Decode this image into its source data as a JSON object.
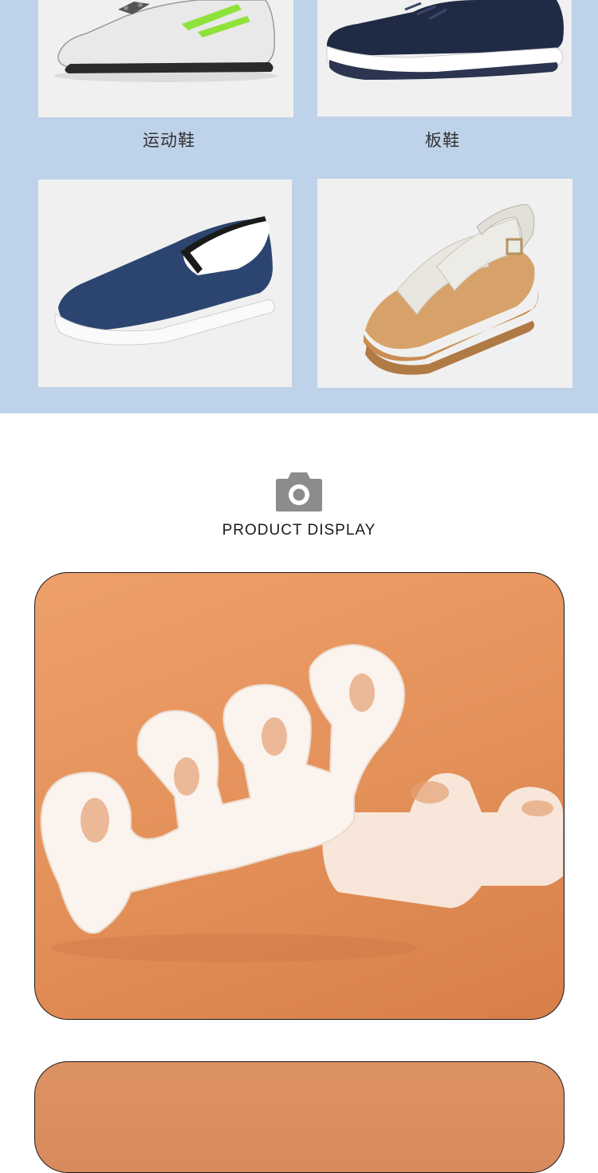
{
  "categories": [
    {
      "label": "运动鞋",
      "image": "sneaker"
    },
    {
      "label": "板鞋",
      "image": "knit-sneaker"
    },
    {
      "label": "",
      "image": "canvas-slip-on"
    },
    {
      "label": "",
      "image": "sandal"
    }
  ],
  "section": {
    "title": "PRODUCT DISPLAY",
    "icon": "camera-icon"
  },
  "colors": {
    "panel_bg": "#bed2ea",
    "photo_bg": "#e4915a"
  }
}
